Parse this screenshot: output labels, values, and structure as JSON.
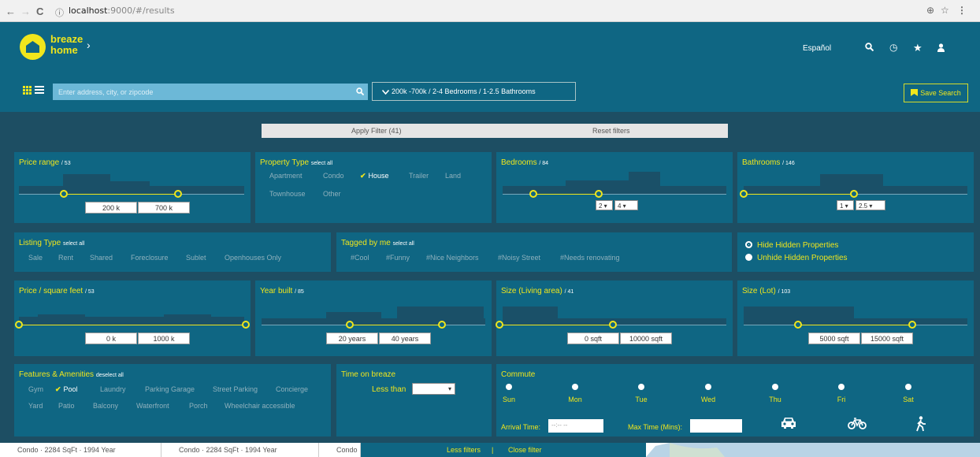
{
  "browser": {
    "url_host": "localhost",
    "url_path": ":9000/#/results",
    "back": "←",
    "forward": "→",
    "reload": "C",
    "info": "ⓘ",
    "icons": [
      "target-icon",
      "star-icon",
      "menu-icon"
    ],
    "right_glyphs": [
      "⊕",
      "☆",
      "⋮"
    ]
  },
  "brand": {
    "line1": "breaze",
    "line2": "home",
    "chevron": "›",
    "accent": "#f0e61c",
    "bg": "#0f6683"
  },
  "header": {
    "language": "Español",
    "icon_glyphs": {
      "search": "🔍",
      "history": "◷",
      "favorites": "★",
      "user": "👤"
    }
  },
  "search": {
    "placeholder": "Enter address, city, or zipcode",
    "search_glyph": "🔍",
    "filter_summary": "200k -700k / 2-4 Bedrooms / 1-2.5 Bathrooms",
    "filter_chevron": "✓",
    "save_label": "Save Search",
    "save_glyph": "▮"
  },
  "actions": {
    "apply": "Apply Filter (41)",
    "reset": "Reset filters"
  },
  "price": {
    "title": "Price range",
    "count": "/ 53",
    "min": "200 k",
    "max": "700 k"
  },
  "property_type": {
    "title": "Property Type",
    "select_all": "select all",
    "options": [
      "Apartment",
      "Condo",
      "House",
      "Trailer",
      "Land",
      "Townhouse",
      "Other"
    ],
    "selected": "House",
    "check": "✔"
  },
  "bedrooms": {
    "title": "Bedrooms",
    "count": "/ 84",
    "min": "2",
    "max": "4"
  },
  "bathrooms": {
    "title": "Bathrooms",
    "count": "/ 146",
    "min": "1",
    "max": "2.5"
  },
  "listing_type": {
    "title": "Listing Type",
    "select_all": "select all",
    "options": [
      "Sale",
      "Rent",
      "Shared",
      "Foreclosure",
      "Sublet",
      "Openhouses Only"
    ]
  },
  "tagged": {
    "title": "Tagged by me",
    "select_all": "select all",
    "options": [
      "#Cool",
      "#Funny",
      "#Nice Neighbors",
      "#Noisy Street",
      "#Needs renovating"
    ]
  },
  "hidden": {
    "hide": "Hide Hidden Properties",
    "unhide": "Unhide Hidden Properties"
  },
  "price_sqft": {
    "title": "Price / square feet",
    "count": "/ 53",
    "min": "0 k",
    "max": "1000 k"
  },
  "year_built": {
    "title": "Year built",
    "count": "/ 85",
    "min": "20 years",
    "max": "40 years"
  },
  "size_living": {
    "title": "Size (Living area)",
    "count": "/ 41",
    "min": "0 sqft",
    "max": "10000 sqft"
  },
  "size_lot": {
    "title": "Size (Lot)",
    "count": "/ 103",
    "min": "5000 sqft",
    "max": "15000 sqft"
  },
  "features": {
    "title": "Features & Amenities",
    "deselect_all": "deselect all",
    "options": [
      "Gym",
      "Pool",
      "Laundry",
      "Parking Garage",
      "Street Parking",
      "Concierge",
      "Yard",
      "Patio",
      "Balcony",
      "Waterfront",
      "Porch",
      "Wheelchair accessible"
    ],
    "selected": "Pool"
  },
  "time_on": {
    "title": "Time on breaze",
    "label": "Less than",
    "select_arrow": "▾"
  },
  "commute": {
    "title": "Commute",
    "days": [
      "Sun",
      "Mon",
      "Tue",
      "Wed",
      "Thu",
      "Fri",
      "Sat"
    ],
    "arrival_label": "Arrival Time:",
    "arrival_placeholder": "--:-- --",
    "max_label": "Max Time (Mins):",
    "mode_glyphs": {
      "car": "🚗",
      "bike": "🚲",
      "walk": "🚶"
    }
  },
  "results": [
    "Condo · 2284 SqFt · 1994 Year",
    "Condo · 2284 SqFt · 1994 Year",
    "Condo ·"
  ],
  "footer": {
    "less": "Less filters",
    "separator": "|",
    "close": "Close filter"
  }
}
